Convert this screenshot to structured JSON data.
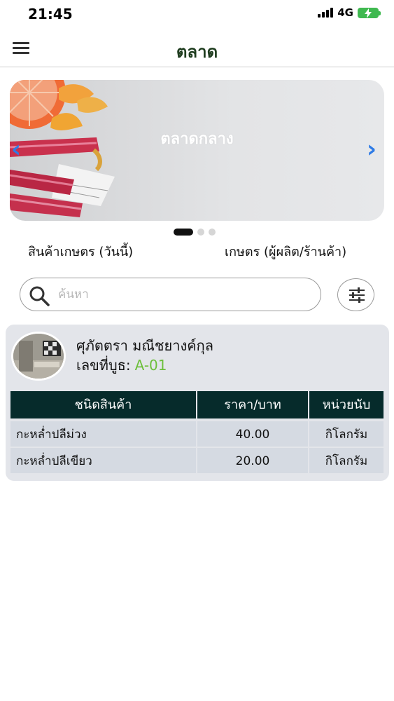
{
  "status_bar": {
    "time": "21:45",
    "network": "4G",
    "icons": [
      "signal-icon",
      "battery-charging-icon"
    ]
  },
  "header": {
    "title": "ตลาด",
    "menu_icon": "hamburger-menu-icon"
  },
  "banner": {
    "title": "ตลาดกลาง",
    "prev_arrow": "‹",
    "next_arrow": "›",
    "slide_count": 3,
    "active_slide": 1,
    "accent_color": "#2e7be6"
  },
  "tabs": [
    {
      "label": "สินค้าเกษตร (วันนี้)"
    },
    {
      "label": "เกษตร (ผู้ผลิต/ร้านค้า)"
    }
  ],
  "search": {
    "placeholder": "ค้นหา",
    "value": ""
  },
  "vendor": {
    "name": "ศุภัตตรา มณีชยางค์กุล",
    "booth_label": "เลขที่บูธ:",
    "booth_code": "A-01",
    "booth_code_color": "#6cbf3a",
    "table": {
      "headers": [
        "ชนิดสินค้า",
        "ราคา/บาท",
        "หน่วยนับ"
      ],
      "rows": [
        [
          "กะหล่ำปลีม่วง",
          "40.00",
          "กิโลกรัม"
        ],
        [
          "กะหล่ำปลีเขียว",
          "20.00",
          "กิโลกรัม"
        ]
      ],
      "header_color": "#062b2b"
    }
  }
}
